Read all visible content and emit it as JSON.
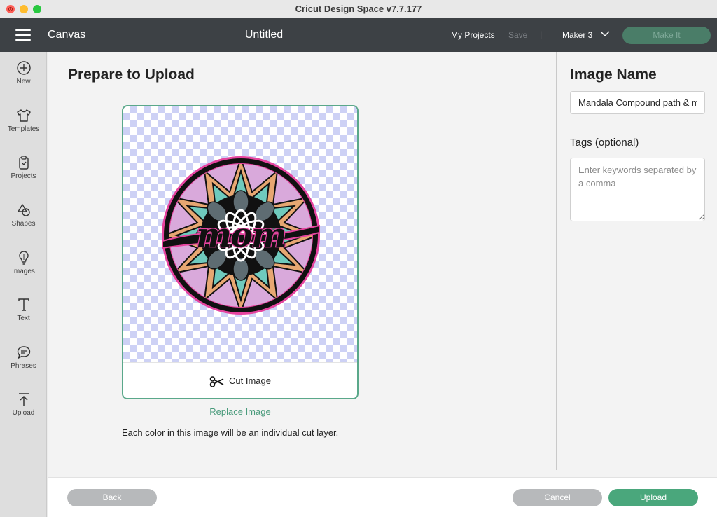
{
  "window": {
    "title": "Cricut Design Space  v7.7.177"
  },
  "header": {
    "section": "Canvas",
    "project_title": "Untitled",
    "my_projects": "My Projects",
    "save": "Save",
    "separator": "|",
    "machine": "Maker 3",
    "make_it": "Make It"
  },
  "sidebar": {
    "items": [
      {
        "label": "New",
        "icon": "plus-circle-icon"
      },
      {
        "label": "Templates",
        "icon": "shirt-icon"
      },
      {
        "label": "Projects",
        "icon": "clipboard-icon"
      },
      {
        "label": "Shapes",
        "icon": "shapes-icon"
      },
      {
        "label": "Images",
        "icon": "lightbulb-icon"
      },
      {
        "label": "Text",
        "icon": "text-icon"
      },
      {
        "label": "Phrases",
        "icon": "speech-bubble-icon"
      },
      {
        "label": "Upload",
        "icon": "upload-icon"
      }
    ]
  },
  "main": {
    "heading": "Prepare to Upload",
    "preview_word": "mom",
    "cut_image": "Cut Image",
    "replace_image": "Replace Image",
    "info": "Each color in this image will be an individual cut layer."
  },
  "details": {
    "image_name_label": "Image Name",
    "image_name_value": "Mandala Compound path & mom",
    "tags_label": "Tags (optional)",
    "tags_placeholder": "Enter keywords separated by a comma",
    "tags_value": ""
  },
  "footer": {
    "back": "Back",
    "cancel": "Cancel",
    "upload": "Upload"
  },
  "colors": {
    "accent": "#4aa77c",
    "header_bg": "#3d4145",
    "checker": "#cdd1f5",
    "mandala_pink": "#e6449f",
    "mandala_teal": "#6fcabd",
    "mandala_orange": "#e7a772",
    "mandala_lavender": "#d9a9db"
  }
}
